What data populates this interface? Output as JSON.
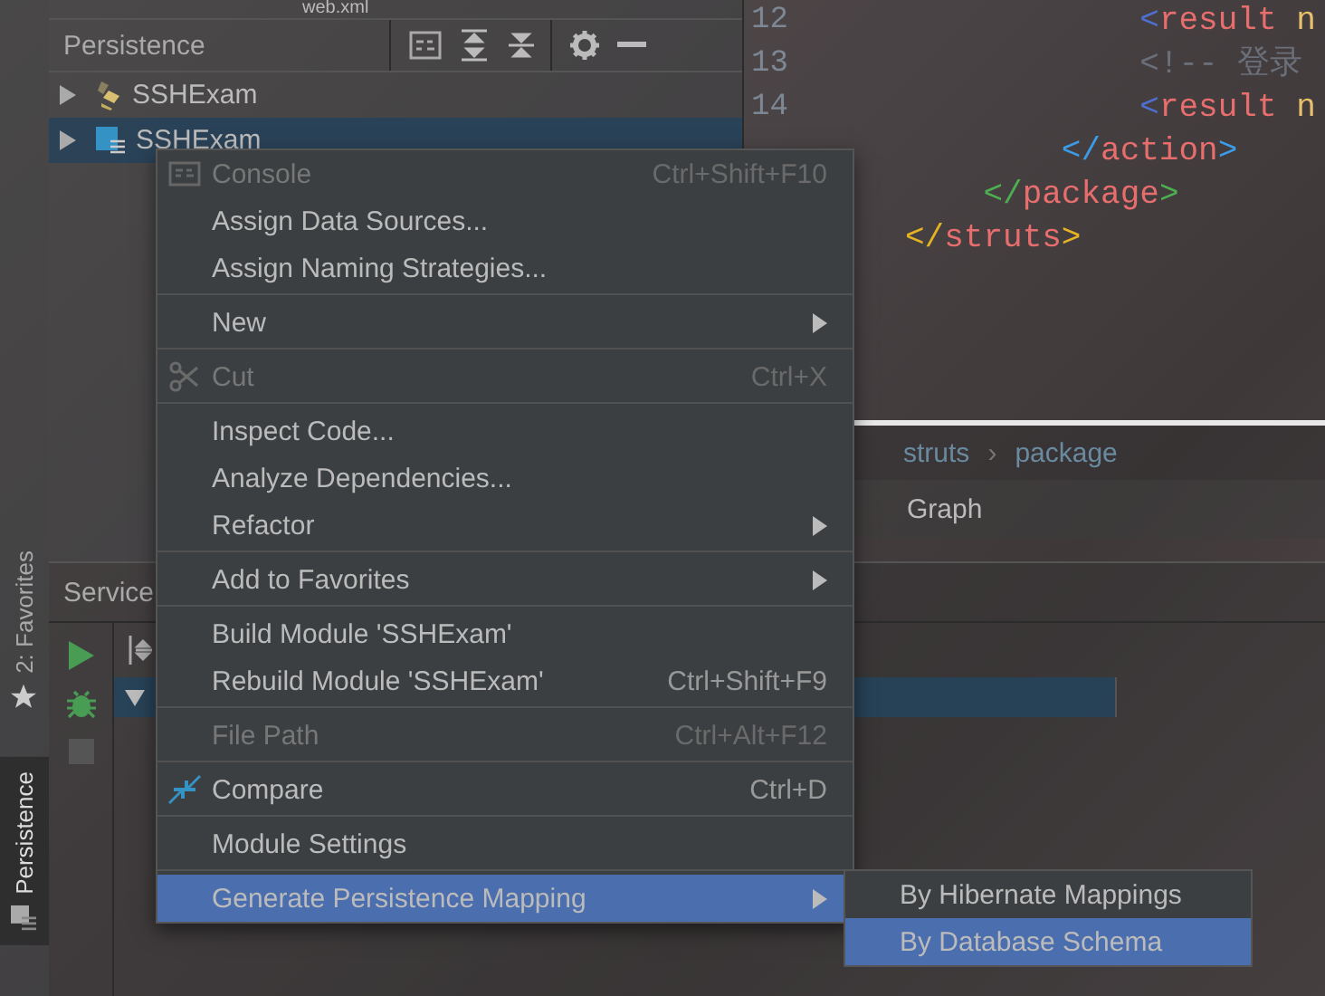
{
  "top_tab": {
    "label": "web.xml"
  },
  "persistence_panel": {
    "title": "Persistence",
    "tree": [
      {
        "label": "SSHExam",
        "kind": "hibernate",
        "selected": false,
        "expanded": false
      },
      {
        "label": "SSHExam",
        "kind": "module",
        "selected": true,
        "expanded": false
      }
    ]
  },
  "editor": {
    "line_numbers": [
      "12",
      "13",
      "14"
    ],
    "lines": [
      {
        "tokens": [
          {
            "text": "            <",
            "color": "#4f6fd0"
          },
          {
            "text": "result ",
            "color": "#e86e6e"
          },
          {
            "text": "n",
            "color": "#e8bf6a"
          }
        ]
      },
      {
        "tokens": [
          {
            "text": "            <!-- 登录",
            "color": "#6b6f7a"
          }
        ]
      },
      {
        "tokens": [
          {
            "text": "            <",
            "color": "#4f6fd0"
          },
          {
            "text": "result ",
            "color": "#e86e6e"
          },
          {
            "text": "n",
            "color": "#e8bf6a"
          }
        ]
      },
      {
        "tokens": [
          {
            "text": "        </",
            "color": "#3c9ce8"
          },
          {
            "text": "action",
            "color": "#e86e6e"
          },
          {
            "text": ">",
            "color": "#3c9ce8"
          }
        ]
      },
      {
        "tokens": [
          {
            "text": "    </",
            "color": "#4caf50"
          },
          {
            "text": "package",
            "color": "#e86e6e"
          },
          {
            "text": ">",
            "color": "#4caf50"
          }
        ]
      },
      {
        "tokens": [
          {
            "text": "</",
            "color": "#e6b422"
          },
          {
            "text": "struts",
            "color": "#e86e6e"
          },
          {
            "text": ">",
            "color": "#e6b422"
          }
        ]
      }
    ],
    "breadcrumbs": [
      "struts",
      "package"
    ],
    "breadcrumb_separator": "›",
    "bottom_tabs": [
      {
        "label": "Graph",
        "selected": false
      }
    ]
  },
  "services_panel": {
    "title": "Service",
    "tree_row": {
      "expanded": true,
      "selected": true
    }
  },
  "side_stripe": [
    {
      "label": "2: Favorites",
      "kind": "favorites",
      "selected": false
    },
    {
      "label": "Persistence",
      "kind": "persistence",
      "selected": true
    }
  ],
  "context_menu": [
    {
      "kind": "console",
      "label": "Console",
      "shortcut": "Ctrl+Shift+F10",
      "disabled": true,
      "submenu": false,
      "selected": false
    },
    {
      "kind": "item",
      "label": "Assign Data Sources...",
      "disabled": false,
      "submenu": false,
      "selected": false
    },
    {
      "kind": "item",
      "label": "Assign Naming Strategies...",
      "disabled": false,
      "submenu": false,
      "selected": false
    },
    {
      "kind": "separator"
    },
    {
      "kind": "item",
      "label": "New",
      "disabled": false,
      "submenu": true,
      "selected": false
    },
    {
      "kind": "separator"
    },
    {
      "kind": "cut",
      "label": "Cut",
      "shortcut": "Ctrl+X",
      "disabled": true,
      "submenu": false,
      "selected": false
    },
    {
      "kind": "separator"
    },
    {
      "kind": "item",
      "label": "Inspect Code...",
      "disabled": false,
      "submenu": false,
      "selected": false
    },
    {
      "kind": "item",
      "label": "Analyze Dependencies...",
      "disabled": false,
      "submenu": false,
      "selected": false
    },
    {
      "kind": "item",
      "label": "Refactor",
      "disabled": false,
      "submenu": true,
      "selected": false
    },
    {
      "kind": "separator"
    },
    {
      "kind": "item",
      "label": "Add to Favorites",
      "disabled": false,
      "submenu": true,
      "selected": false
    },
    {
      "kind": "separator"
    },
    {
      "kind": "item",
      "label": "Build Module 'SSHExam'",
      "disabled": false,
      "submenu": false,
      "selected": false
    },
    {
      "kind": "item",
      "label": "Rebuild Module 'SSHExam'",
      "shortcut": "Ctrl+Shift+F9",
      "disabled": false,
      "submenu": false,
      "selected": false
    },
    {
      "kind": "separator"
    },
    {
      "kind": "item",
      "label": "File Path",
      "shortcut": "Ctrl+Alt+F12",
      "disabled": true,
      "submenu": false,
      "selected": false
    },
    {
      "kind": "separator"
    },
    {
      "kind": "compare",
      "label": "Compare",
      "shortcut": "Ctrl+D",
      "disabled": false,
      "submenu": false,
      "selected": false
    },
    {
      "kind": "separator"
    },
    {
      "kind": "item",
      "label": "Module Settings",
      "disabled": false,
      "submenu": false,
      "selected": false
    },
    {
      "kind": "separator"
    },
    {
      "kind": "item",
      "label": "Generate Persistence Mapping",
      "disabled": false,
      "submenu": true,
      "selected": true
    }
  ],
  "submenu": [
    {
      "label": "By Hibernate Mappings",
      "selected": false
    },
    {
      "label": "By Database Schema",
      "selected": true
    }
  ]
}
